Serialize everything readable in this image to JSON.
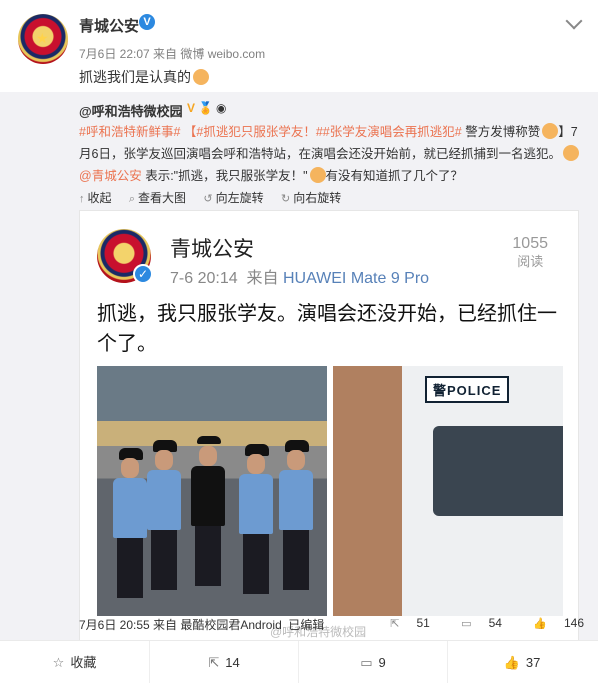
{
  "post": {
    "username": "青城公安",
    "verified_mark": "V",
    "meta": "7月6日 22:07 来自 微博 weibo.com",
    "text": "抓逃我们是认真的"
  },
  "repost": {
    "username": "@呼和浩特微校园",
    "text_parts": {
      "tag1": "#呼和浩特新鲜事#",
      "tag2": "【#抓逃犯只服张学友！#",
      "tag3": "#张学友演唱会再抓逃犯#",
      "after_tags": "警方发博称赞",
      "body": "】7月6日，张学友巡回演唱会呼和浩特站，在演唱会还没开始前，就已经抓捕到一名逃犯。",
      "mention": "@青城公安",
      "quote": "表示:\"抓逃，我只服张学友！\"",
      "tail": "有没有知道抓了几个了？"
    },
    "tools": [
      "收起",
      "查看大图",
      "向左旋转",
      "向右旋转"
    ],
    "image": {
      "name": "青城公安",
      "time": "7-6 20:14",
      "source_prefix": "来自",
      "device": "HUAWEI Mate 9 Pro",
      "views": "1055",
      "views_label": "阅读",
      "text": "抓逃，我只服张学友。演唱会还没开始，已经抓住一个了。",
      "police_sign": "警POLICE",
      "watermark": "@呼和浩特微校园"
    },
    "footer": {
      "meta": "7月6日 20:55 来自 最酷校园君Android",
      "edited": "已编辑",
      "reposts": "51",
      "comments": "54",
      "likes": "146"
    }
  },
  "actions": {
    "favorite": "收藏",
    "repost": "14",
    "comment": "9",
    "like": "37"
  },
  "colors": {
    "accent": "#eb7350",
    "link": "#5781b8",
    "verified": "#2c89e0",
    "repost_bg": "#f2f2f5"
  }
}
